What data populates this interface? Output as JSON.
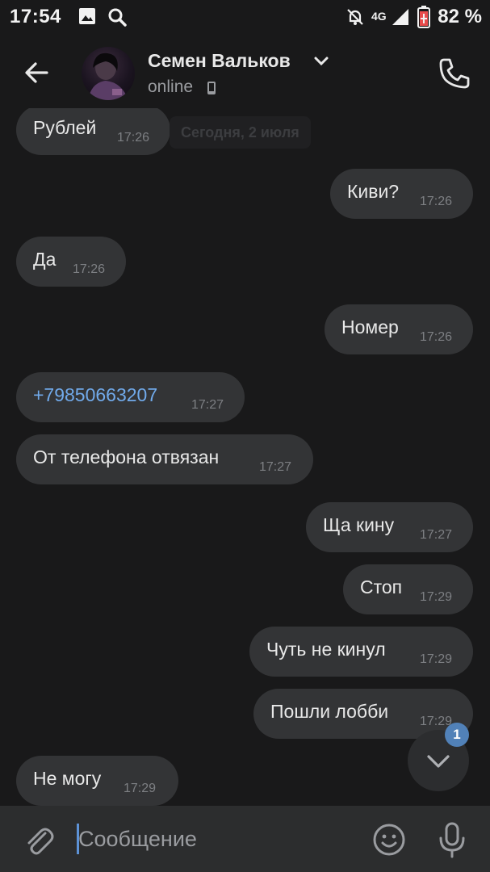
{
  "status_bar": {
    "time": "17:54",
    "network": "4G",
    "battery": "82 %",
    "icons": [
      "image-icon",
      "search-icon",
      "bell-off-icon",
      "signal-icon",
      "battery-icon"
    ]
  },
  "header": {
    "contact_name": "Семен Вальков",
    "status": "online",
    "icons": [
      "back-arrow-icon",
      "chevron-down-icon",
      "mobile-phone-icon",
      "phone-call-icon"
    ]
  },
  "chat": {
    "date_separator": "Сегодня, 2 июля",
    "messages": [
      {
        "side": "in",
        "text": "Рублей",
        "time": "17:26"
      },
      {
        "side": "out",
        "text": "Киви?",
        "time": "17:26"
      },
      {
        "side": "in",
        "text": "Да",
        "time": "17:26"
      },
      {
        "side": "out",
        "text": "Номер",
        "time": "17:26"
      },
      {
        "side": "in",
        "text": "+79850663207",
        "time": "17:27",
        "is_link": true
      },
      {
        "side": "in",
        "text": "От телефона отвязан",
        "time": "17:27"
      },
      {
        "side": "out",
        "text": "Ща кину",
        "time": "17:27"
      },
      {
        "side": "out",
        "text": "Стоп",
        "time": "17:29"
      },
      {
        "side": "out",
        "text": "Чуть не кинул",
        "time": "17:29"
      },
      {
        "side": "out",
        "text": "Пошли лобби",
        "time": "17:29"
      },
      {
        "side": "in",
        "text": "Не могу",
        "time": "17:29"
      }
    ],
    "scroll_down_badge": "1"
  },
  "composer": {
    "placeholder": "Сообщение",
    "value": "",
    "icons": [
      "paperclip-icon",
      "emoji-icon",
      "microphone-icon"
    ]
  },
  "colors": {
    "background": "#19191a",
    "bubble": "#333436",
    "link": "#71aaeb",
    "accent": "#5181b8",
    "composer": "#2c2d2e"
  }
}
